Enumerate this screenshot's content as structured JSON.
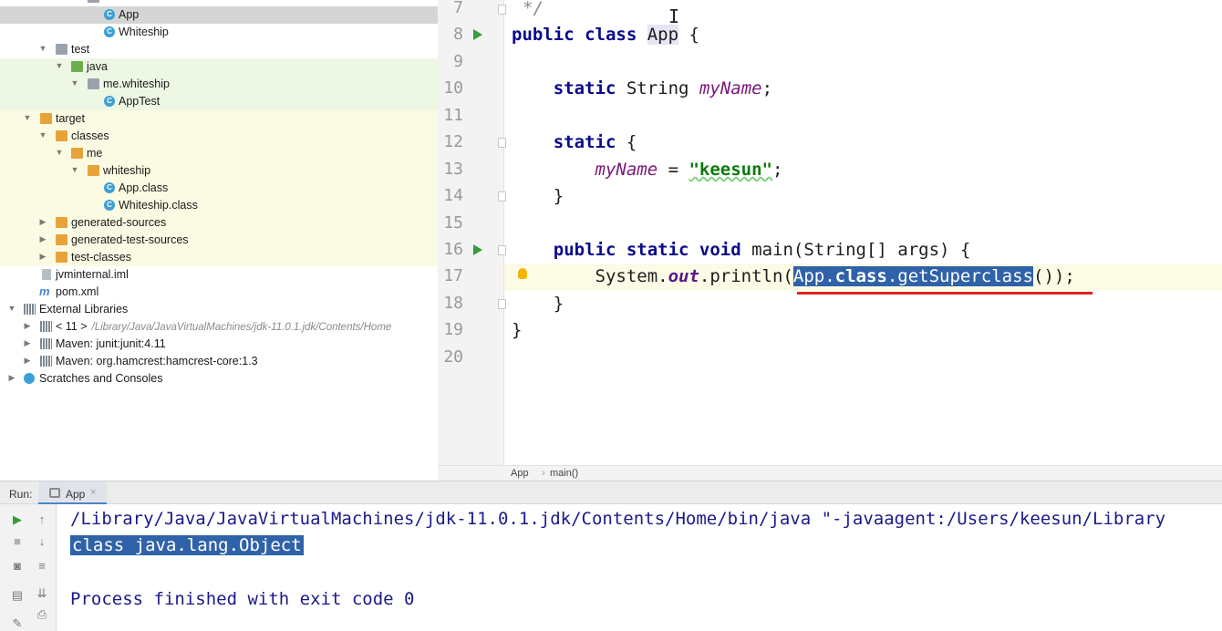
{
  "project_tree": {
    "items": [
      {
        "label": "App"
      },
      {
        "label": "Whiteship"
      },
      {
        "label": "test"
      },
      {
        "label": "java"
      },
      {
        "label": "me.whiteship"
      },
      {
        "label": "AppTest"
      },
      {
        "label": "target"
      },
      {
        "label": "classes"
      },
      {
        "label": "me"
      },
      {
        "label": "whiteship"
      },
      {
        "label": "App.class"
      },
      {
        "label": "Whiteship.class"
      },
      {
        "label": "generated-sources"
      },
      {
        "label": "generated-test-sources"
      },
      {
        "label": "test-classes"
      },
      {
        "label": "jvminternal.iml"
      },
      {
        "label": "pom.xml"
      },
      {
        "label": "External Libraries"
      },
      {
        "label": "< 11 >",
        "sub": "/Library/Java/JavaVirtualMachines/jdk-11.0.1.jdk/Contents/Home"
      },
      {
        "label": "Maven: junit:junit:4.11"
      },
      {
        "label": "Maven: org.hamcrest:hamcrest-core:1.3"
      },
      {
        "label": "Scratches and Consoles"
      }
    ]
  },
  "editor": {
    "line_numbers": [
      "7",
      "8",
      "9",
      "10",
      "11",
      "12",
      "13",
      "14",
      "15",
      "16",
      "17",
      "18",
      "19",
      "20"
    ],
    "code": {
      "l7": "*/",
      "l8_kw": "public class",
      "l8_name": "App",
      "l8_brace": "{",
      "l10_kw": "static",
      "l10_type": "String",
      "l10_field": "myName",
      "l10_end": ";",
      "l12_kw": "static",
      "l12_brace": "{",
      "l13_field": "myName",
      "l13_eq": " = ",
      "l13_str": "\"keesun\"",
      "l13_end": ";",
      "l14": "}",
      "l16_kw": "public static void",
      "l16_rest": "main(String[] args) {",
      "l17_pre": "System.",
      "l17_out": "out",
      "l17_mid": ".println(",
      "l17_sel_a": "App.",
      "l17_sel_kw": "class",
      "l17_sel_b": ".getSuperclass",
      "l17_end": "());",
      "l18": "}",
      "l19": "}"
    }
  },
  "breadcrumb": {
    "items": [
      "App",
      "main()"
    ],
    "separator": "›"
  },
  "run_panel": {
    "label": "Run:",
    "tab_label": "App",
    "tab_close": "×",
    "console_lines": [
      "/Library/Java/JavaVirtualMachines/jdk-11.0.1.jdk/Contents/Home/bin/java \"-javaagent:/Users/keesun/Library",
      "class java.lang.Object",
      "",
      "Process finished with exit code 0"
    ]
  }
}
